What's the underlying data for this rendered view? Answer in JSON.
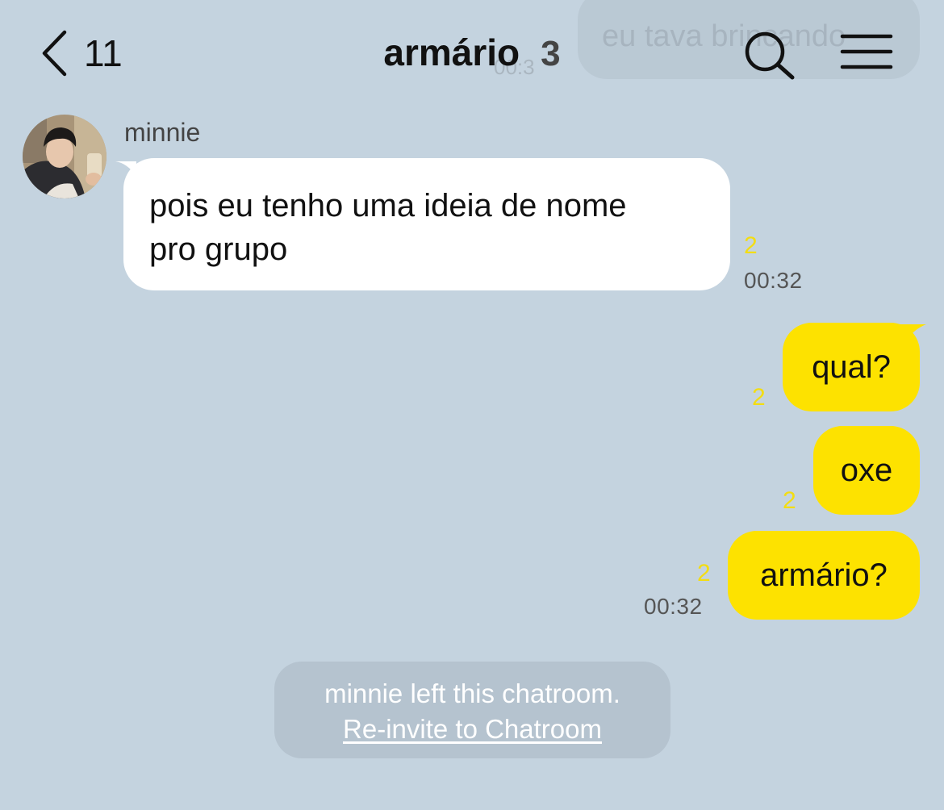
{
  "header": {
    "back_count": "11",
    "title": "armário",
    "member_count": "3"
  },
  "ghost_message": {
    "text": "eu tava brincando",
    "time": "00:3"
  },
  "messages": [
    {
      "sender": "minnie",
      "lines": [
        "pois eu tenho uma ideia de nome",
        "pro grupo"
      ],
      "unread": "2",
      "time": "00:32"
    },
    {
      "outgoing": true,
      "text": "qual?",
      "unread": "2"
    },
    {
      "outgoing": true,
      "text": "oxe",
      "unread": "2"
    },
    {
      "outgoing": true,
      "text": "armário?",
      "unread": "2",
      "time": "00:32"
    }
  ],
  "notice": {
    "text": "minnie left this chatroom.",
    "link": "Re-invite to Chatroom"
  },
  "colors": {
    "background": "#c4d3df",
    "outgoing_bubble": "#fde200",
    "incoming_bubble": "#ffffff",
    "unread_count": "#f3dd12"
  },
  "icons": [
    "chevron-left-icon",
    "search-icon",
    "menu-icon"
  ]
}
